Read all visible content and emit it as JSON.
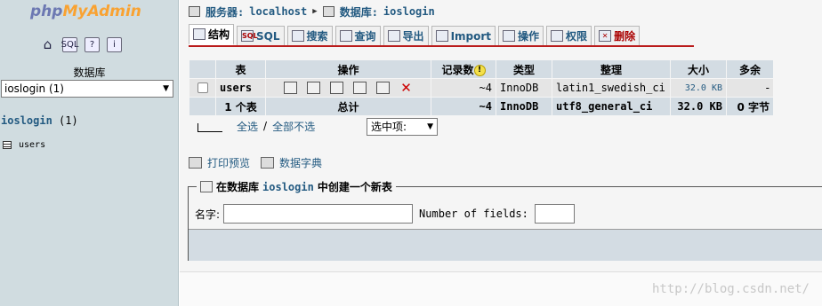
{
  "left": {
    "logo": {
      "php": "php",
      "my": "My",
      "admin": "Admin"
    },
    "icons": [
      "home-icon",
      "sql-icon",
      "help-icon",
      "docs-icon"
    ],
    "database_label": "数据库",
    "database_select": "ioslogin (1)",
    "current_db": "ioslogin",
    "current_db_count": "(1)",
    "tables": [
      "users"
    ]
  },
  "breadcrumb": {
    "server_label": "服务器:",
    "server": "localhost",
    "db_label": "数据库:",
    "db": "ioslogin"
  },
  "tabs": [
    {
      "label": "结构",
      "active": true
    },
    {
      "label": "SQL"
    },
    {
      "label": "搜索"
    },
    {
      "label": "查询"
    },
    {
      "label": "导出"
    },
    {
      "label": "Import"
    },
    {
      "label": "操作"
    },
    {
      "label": "权限"
    },
    {
      "label": "删除"
    }
  ],
  "table": {
    "headers": [
      "表",
      "操作",
      "记录数",
      "类型",
      "整理",
      "大小",
      "多余"
    ],
    "rows": [
      {
        "name": "users",
        "records": "~4",
        "type": "InnoDB",
        "collation": "latin1_swedish_ci",
        "size": "32.0 KB",
        "overhead": "-"
      }
    ],
    "footer": {
      "count": "1 个表",
      "label": "总计",
      "records": "~4",
      "type": "InnoDB",
      "collation": "utf8_general_ci",
      "size": "32.0 KB",
      "overhead": "0 字节"
    }
  },
  "checkall": {
    "all": "全选",
    "sep": "/",
    "none": "全部不选",
    "with_selected": "选中项:"
  },
  "print": {
    "print_view": "打印预览",
    "dictionary": "数据字典"
  },
  "create": {
    "legend_pre": "在数据库",
    "db": "ioslogin",
    "legend_post": "中创建一个新表",
    "name_label": "名字:",
    "fields_label": "Number of fields:"
  },
  "watermark": "http://blog.csdn.net/"
}
